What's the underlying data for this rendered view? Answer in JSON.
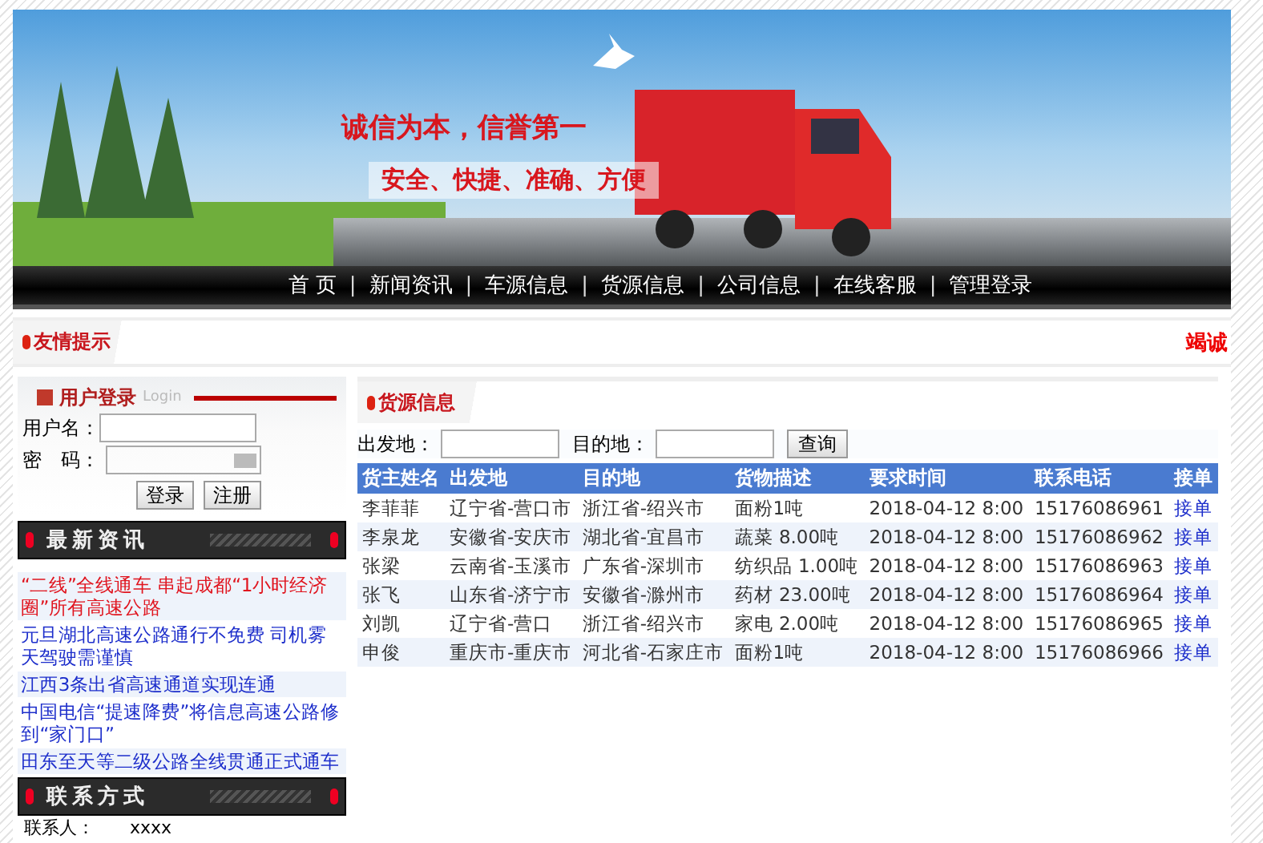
{
  "banner": {
    "slogan": "诚信为本，信誉第一",
    "tagline": "安全、快捷、准确、方便"
  },
  "nav": {
    "items": [
      "首 页",
      "新闻资讯",
      "车源信息",
      "货源信息",
      "公司信息",
      "在线客服",
      "管理登录"
    ],
    "separator": "|"
  },
  "notice": {
    "title": "友情提示",
    "marquee": "竭诚"
  },
  "login": {
    "title": "用户登录",
    "subtitle": "Login",
    "fields": [
      {
        "label": "用户名：",
        "kind": "text"
      },
      {
        "label": "密　码：",
        "kind": "password"
      }
    ],
    "buttons": [
      "登录",
      "注册"
    ]
  },
  "news": {
    "title": "最新资讯",
    "items": [
      {
        "text": "“二线”全线通车 串起成都“1小时经济圈”所有高速公路",
        "highlighted": true
      },
      {
        "text": "元旦湖北高速公路通行不免费 司机雾天驾驶需谨慎",
        "highlighted": false
      },
      {
        "text": "江西3条出省高速通道实现连通",
        "highlighted": false
      },
      {
        "text": "中国电信“提速降费”将信息高速公路修到“家门口”",
        "highlighted": false
      },
      {
        "text": "田东至天等二级公路全线贯通正式通车",
        "highlighted": false
      }
    ]
  },
  "contact": {
    "title": "联系方式",
    "rows": [
      {
        "label": "联系人：",
        "value": "xxxx"
      }
    ]
  },
  "cargo": {
    "title": "货源信息",
    "filters": [
      {
        "label": "出发地："
      },
      {
        "label": "目的地："
      }
    ],
    "search_button": "查询",
    "columns": [
      "货主姓名",
      "出发地",
      "目的地",
      "货物描述",
      "要求时间",
      "联系电话",
      "接单"
    ],
    "rows": [
      [
        "李菲菲",
        "辽宁省-营口市",
        "浙江省-绍兴市",
        "面粉1吨",
        "2018-04-12 8:00",
        "15176086961",
        "接单"
      ],
      [
        "李泉龙",
        "安徽省-安庆市",
        "湖北省-宜昌市",
        "蔬菜 8.00吨",
        "2018-04-12 8:00",
        "15176086962",
        "接单"
      ],
      [
        "张梁",
        "云南省-玉溪市",
        "广东省-深圳市",
        "纺织品 1.00吨",
        "2018-04-12 8:00",
        "15176086963",
        "接单"
      ],
      [
        "张飞",
        "山东省-济宁市",
        "安徽省-滁州市",
        "药材 23.00吨",
        "2018-04-12 8:00",
        "15176086964",
        "接单"
      ],
      [
        "刘凯",
        "辽宁省-营口",
        "浙江省-绍兴市",
        "家电 2.00吨",
        "2018-04-12 8:00",
        "15176086965",
        "接单"
      ],
      [
        "申俊",
        "重庆市-重庆市",
        "河北省-石家庄市",
        "面粉1吨",
        "2018-04-12 8:00",
        "15176086966",
        "接单"
      ]
    ]
  }
}
